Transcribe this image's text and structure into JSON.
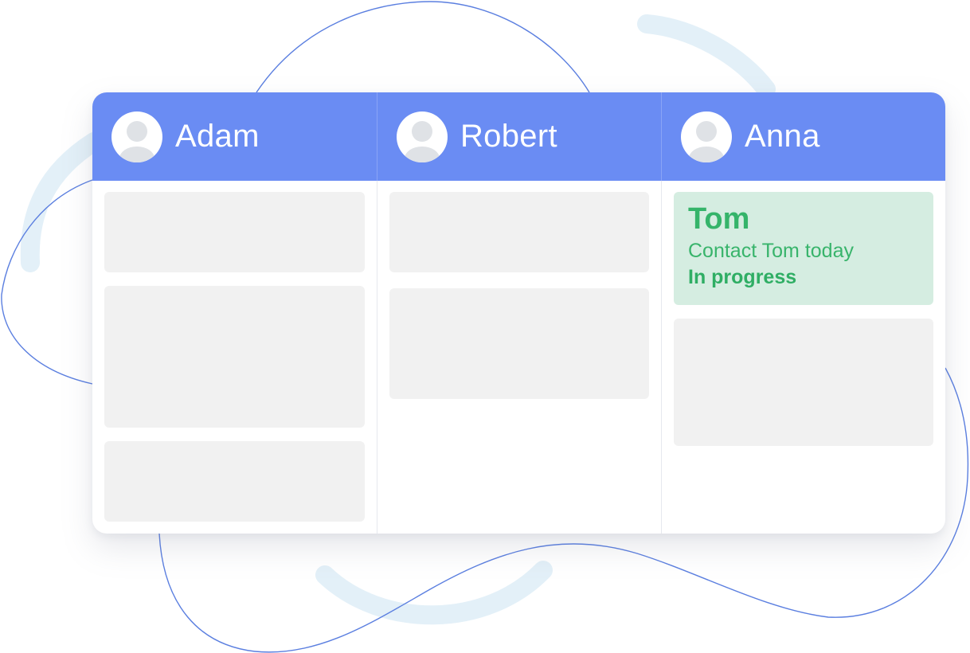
{
  "board": {
    "columns": [
      {
        "name": "Adam",
        "cards": [
          {
            "kind": "placeholder"
          },
          {
            "kind": "placeholder"
          },
          {
            "kind": "placeholder"
          }
        ]
      },
      {
        "name": "Robert",
        "cards": [
          {
            "kind": "placeholder"
          },
          {
            "kind": "placeholder"
          }
        ]
      },
      {
        "name": "Anna",
        "cards": [
          {
            "kind": "task",
            "title": "Tom",
            "description": "Contact Tom today",
            "status": "In progress"
          },
          {
            "kind": "placeholder"
          }
        ]
      }
    ]
  },
  "colors": {
    "header": "#6a8cf3",
    "placeholder_card": "#f1f1f1",
    "task_card": "#d5ede1",
    "task_text": "#35b46a",
    "decor_line": "#5b7fe0",
    "decor_arc": "#e3f0f8"
  },
  "icons": {
    "avatar": "user-avatar-icon"
  }
}
